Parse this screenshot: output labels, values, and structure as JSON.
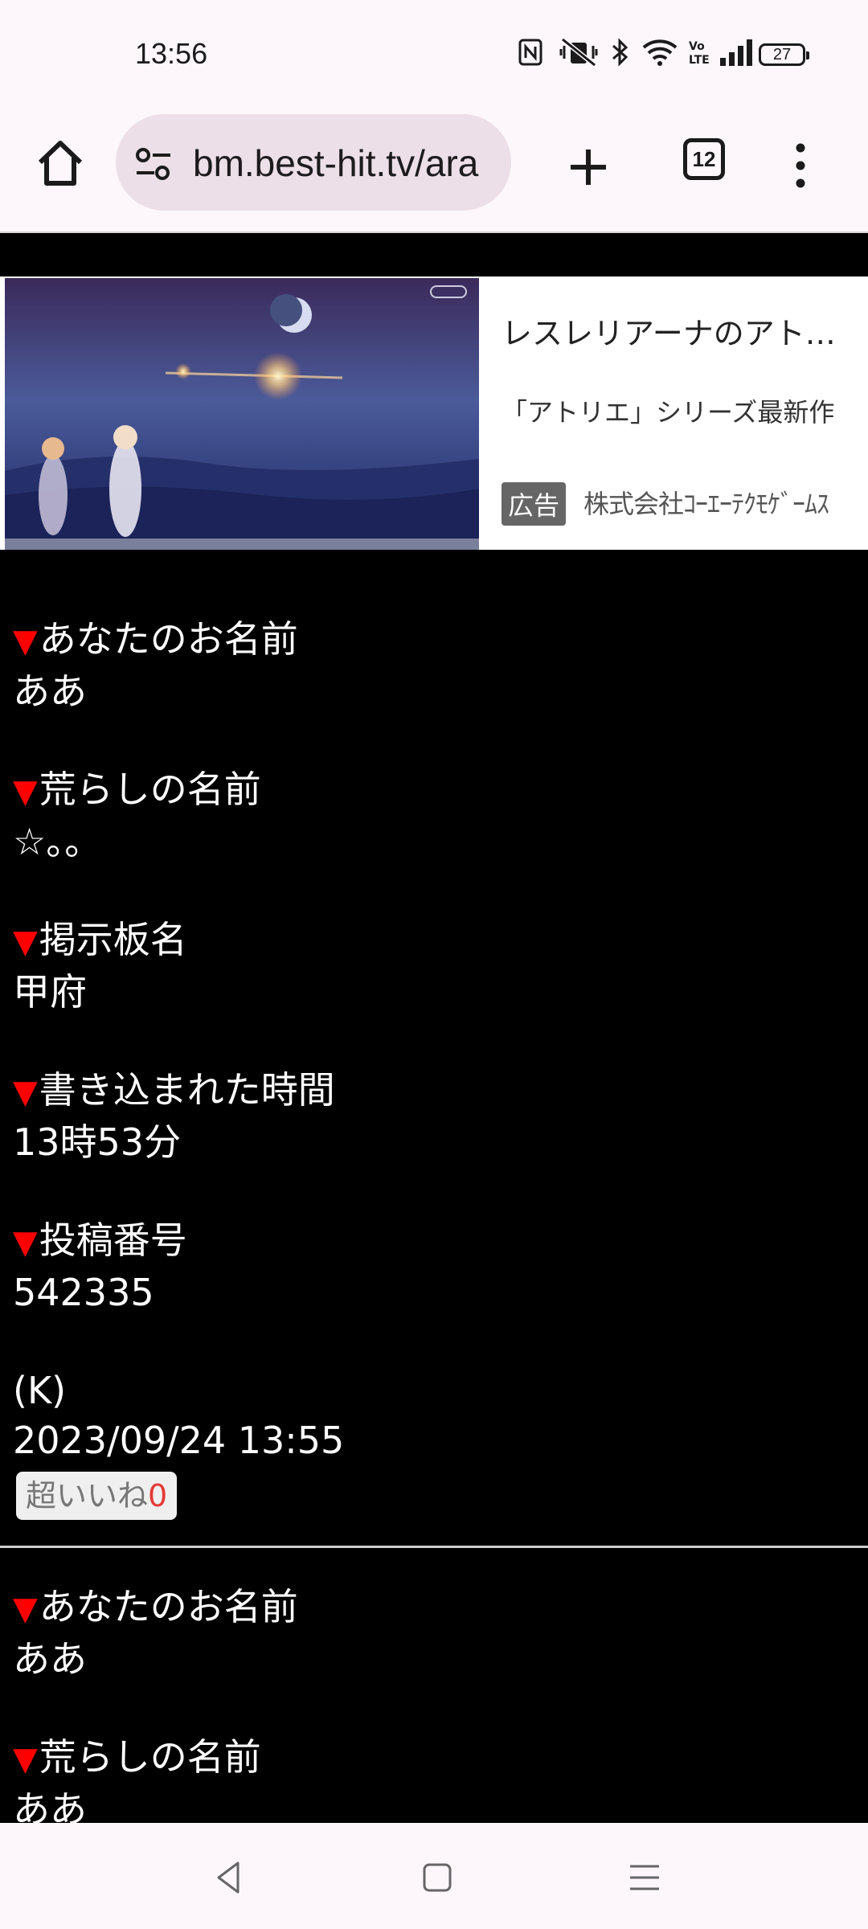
{
  "status": {
    "time": "13:56",
    "battery": "27"
  },
  "browser": {
    "url": "bm.best-hit.tv/ara",
    "tab_count": "12"
  },
  "ad": {
    "title": "レスレリアーナのアトリエ",
    "description": "「アトリエ」シリーズ最新作",
    "badge": "広告",
    "advertiser": "株式会社ｺｰｴｰﾃｸﾓｹﾞｰﾑｽ"
  },
  "posts": [
    {
      "fields": [
        {
          "label": "あなたのお名前",
          "value": "ああ"
        },
        {
          "label": "荒らしの名前",
          "value": "☆。。"
        },
        {
          "label": "掲示板名",
          "value": "甲府"
        },
        {
          "label": "書き込まれた時間",
          "value": "13時53分"
        },
        {
          "label": "投稿番号",
          "value": "542335"
        }
      ],
      "author": "(K)",
      "datetime": "2023/09/24 13:55",
      "like_label": "超いいね",
      "like_count": "0"
    },
    {
      "fields": [
        {
          "label": "あなたのお名前",
          "value": "ああ"
        },
        {
          "label": "荒らしの名前",
          "value": "ああ"
        }
      ]
    }
  ],
  "colors": {
    "accent_triangle": "#ff0000",
    "like_count": "#e53935"
  }
}
